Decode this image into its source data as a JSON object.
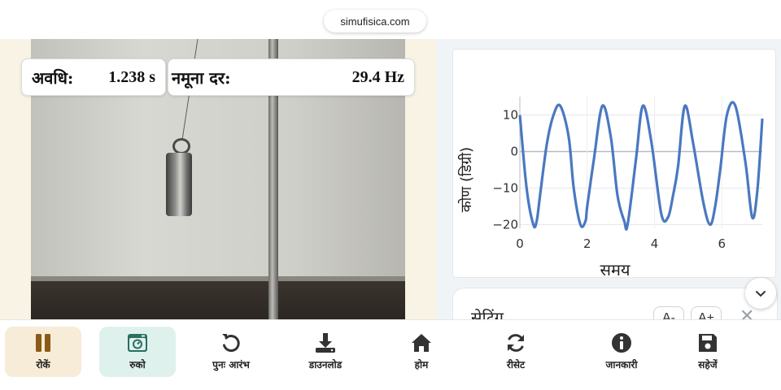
{
  "browser": {
    "url": "simufisica.com"
  },
  "readouts": {
    "period_label": "अवधि:",
    "period_value": "1.238 s",
    "rate_label": "नमूना दर:",
    "rate_value": "29.4 Hz"
  },
  "chart_data": {
    "type": "line",
    "xlabel": "समय",
    "ylabel": "कोण (डिग्री)",
    "xlim": [
      0,
      7.2
    ],
    "ylim": [
      -21,
      15
    ],
    "xticks": [
      0,
      2,
      4,
      6
    ],
    "yticks": [
      10,
      0,
      -10,
      -20
    ],
    "grid": true,
    "color": "#4a78c1",
    "series": [
      {
        "x": [
          0,
          0.2,
          0.4,
          0.5,
          0.6,
          0.8,
          1.0,
          1.2,
          1.45,
          1.6,
          1.8,
          1.95,
          2.0,
          2.2,
          2.45,
          2.7,
          2.9,
          3.1,
          3.2,
          3.45,
          3.65,
          3.9,
          4.2,
          4.4,
          4.55,
          4.7,
          4.9,
          5.15,
          5.45,
          5.65,
          5.8,
          5.95,
          6.15,
          6.4,
          6.7,
          6.9,
          7.05,
          7.2
        ],
        "y": [
          10,
          -10,
          -20,
          -19,
          -12,
          2,
          10,
          12.5,
          4,
          -10,
          -20,
          -19,
          -15,
          -2,
          12.5,
          4,
          -12,
          -19,
          -20,
          -2,
          12.5,
          3,
          -17,
          -18,
          -12,
          -4,
          12.5,
          2,
          -14,
          -20,
          -15,
          -5,
          10,
          12.5,
          -3,
          -18,
          -11,
          9
        ]
      }
    ]
  },
  "settings": {
    "title": "सेटिंग",
    "font_minus": "A-",
    "font_plus": "A+"
  },
  "toolbar": {
    "items": [
      {
        "label": "रोकें",
        "icon": "pause-icon"
      },
      {
        "label": "रुको",
        "icon": "camera-icon"
      },
      {
        "label": "पुनः आरंभ",
        "icon": "restart-icon"
      },
      {
        "label": "डाउनलोड",
        "icon": "download-icon"
      },
      {
        "label": "होम",
        "icon": "home-icon"
      },
      {
        "label": "रीसेट",
        "icon": "reset-icon"
      },
      {
        "label": "जानकारी",
        "icon": "info-icon"
      },
      {
        "label": "सहेजें",
        "icon": "save-icon"
      }
    ],
    "colors": {
      "pause_bg": "#f7ecd7",
      "capture_bg": "#dff1ec",
      "pause_icon": "#8a5a16",
      "capture_icon": "#2c6e63"
    }
  }
}
